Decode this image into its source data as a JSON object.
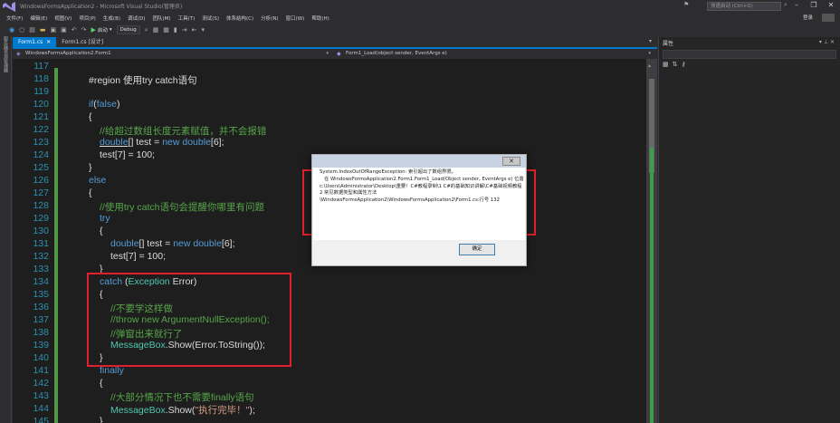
{
  "window": {
    "title": "WindowsFormsApplication2 - Microsoft Visual Studio(管理员)",
    "quick_launch_placeholder": "快速启动 (Ctrl+Q)",
    "minimize": "–",
    "restore": "❐",
    "close": "✕"
  },
  "menu": {
    "items": [
      "文件(F)",
      "编辑(E)",
      "视图(V)",
      "项目(P)",
      "生成(B)",
      "调试(D)",
      "团队(M)",
      "工具(T)",
      "测试(S)",
      "体系结构(C)",
      "分析(N)",
      "窗口(W)",
      "帮助(H)"
    ],
    "signin": "登录"
  },
  "toolbar": {
    "start_label": "启动",
    "config": "Debug"
  },
  "left_strip": {
    "label": "服务器资源管理器"
  },
  "tabs": [
    {
      "label": "Form1.cs",
      "active": true
    },
    {
      "label": "Form1.cs [设计]",
      "active": false
    }
  ],
  "navbar": {
    "class_combo": "WindowsFormsApplication2.Form1",
    "member_combo": "Form1_Load(object sender, EventArgs e)"
  },
  "properties": {
    "title": "属性"
  },
  "editor": {
    "lines": [
      {
        "n": "117",
        "indent": 0,
        "tokens": []
      },
      {
        "n": "118",
        "indent": 1,
        "tokens": [
          {
            "c": "pl",
            "t": "#region 使用try catch语句"
          }
        ]
      },
      {
        "n": "119",
        "indent": 0,
        "tokens": []
      },
      {
        "n": "120",
        "indent": 1,
        "tokens": [
          {
            "c": "kw",
            "t": "if"
          },
          {
            "c": "pl",
            "t": "("
          },
          {
            "c": "kw",
            "t": "false"
          },
          {
            "c": "pl",
            "t": ")"
          }
        ]
      },
      {
        "n": "121",
        "indent": 1,
        "tokens": [
          {
            "c": "pl",
            "t": "{"
          }
        ]
      },
      {
        "n": "122",
        "indent": 2,
        "tokens": [
          {
            "c": "cm",
            "t": "//给超过数组长度元素赋值，并不会报错"
          }
        ]
      },
      {
        "n": "123",
        "indent": 2,
        "tokens": [
          {
            "c": "kw ul",
            "t": "double"
          },
          {
            "c": "pl",
            "t": "[] test = "
          },
          {
            "c": "kw",
            "t": "new"
          },
          {
            "c": "pl",
            "t": " "
          },
          {
            "c": "kw",
            "t": "double"
          },
          {
            "c": "pl",
            "t": "[6];"
          }
        ]
      },
      {
        "n": "124",
        "indent": 2,
        "tokens": [
          {
            "c": "pl",
            "t": "test[7] = 100;"
          }
        ]
      },
      {
        "n": "125",
        "indent": 1,
        "tokens": [
          {
            "c": "pl",
            "t": "}"
          }
        ]
      },
      {
        "n": "126",
        "indent": 1,
        "tokens": [
          {
            "c": "kw",
            "t": "else"
          }
        ]
      },
      {
        "n": "127",
        "indent": 1,
        "tokens": [
          {
            "c": "pl",
            "t": "{"
          }
        ]
      },
      {
        "n": "128",
        "indent": 2,
        "tokens": [
          {
            "c": "cm",
            "t": "//使用try catch语句会提醒你哪里有问题"
          }
        ]
      },
      {
        "n": "129",
        "indent": 2,
        "tokens": [
          {
            "c": "kw",
            "t": "try"
          }
        ]
      },
      {
        "n": "130",
        "indent": 2,
        "tokens": [
          {
            "c": "pl",
            "t": "{"
          }
        ]
      },
      {
        "n": "131",
        "indent": 3,
        "tokens": [
          {
            "c": "kw",
            "t": "double"
          },
          {
            "c": "pl",
            "t": "[] test = "
          },
          {
            "c": "kw",
            "t": "new"
          },
          {
            "c": "pl",
            "t": " "
          },
          {
            "c": "kw",
            "t": "double"
          },
          {
            "c": "pl",
            "t": "[6];"
          }
        ]
      },
      {
        "n": "132",
        "indent": 3,
        "tokens": [
          {
            "c": "pl",
            "t": "test[7] = 100;"
          }
        ]
      },
      {
        "n": "133",
        "indent": 2,
        "tokens": [
          {
            "c": "pl",
            "t": "}"
          }
        ]
      },
      {
        "n": "134",
        "indent": 2,
        "tokens": [
          {
            "c": "kw",
            "t": "catch"
          },
          {
            "c": "pl",
            "t": " ("
          },
          {
            "c": "ty",
            "t": "Exception"
          },
          {
            "c": "pl",
            "t": " Error)"
          }
        ]
      },
      {
        "n": "135",
        "indent": 2,
        "tokens": [
          {
            "c": "pl",
            "t": "{"
          }
        ]
      },
      {
        "n": "136",
        "indent": 3,
        "tokens": [
          {
            "c": "cm",
            "t": "//不要学这样做"
          }
        ]
      },
      {
        "n": "137",
        "indent": 3,
        "tokens": [
          {
            "c": "cm",
            "t": "//throw new ArgumentNullException();"
          }
        ]
      },
      {
        "n": "138",
        "indent": 3,
        "tokens": [
          {
            "c": "cm",
            "t": "//弹窗出来就行了"
          }
        ]
      },
      {
        "n": "139",
        "indent": 3,
        "tokens": [
          {
            "c": "ty",
            "t": "MessageBox"
          },
          {
            "c": "pl",
            "t": ".Show(Error.ToString());"
          }
        ]
      },
      {
        "n": "140",
        "indent": 2,
        "tokens": [
          {
            "c": "pl",
            "t": "}"
          }
        ]
      },
      {
        "n": "141",
        "indent": 2,
        "tokens": [
          {
            "c": "kw",
            "t": "finally"
          }
        ]
      },
      {
        "n": "142",
        "indent": 2,
        "tokens": [
          {
            "c": "pl",
            "t": "{"
          }
        ]
      },
      {
        "n": "143",
        "indent": 3,
        "tokens": [
          {
            "c": "cm",
            "t": "//大部分情况下也不需要finally语句"
          }
        ]
      },
      {
        "n": "144",
        "indent": 3,
        "tokens": [
          {
            "c": "ty",
            "t": "MessageBox"
          },
          {
            "c": "pl",
            "t": ".Show("
          },
          {
            "c": "st",
            "t": "\"执行完毕！\""
          },
          {
            "c": "pl",
            "t": ");"
          }
        ]
      },
      {
        "n": "145",
        "indent": 2,
        "tokens": [
          {
            "c": "pl",
            "t": "}"
          }
        ]
      }
    ]
  },
  "dialog": {
    "message": "System.IndexOutOfRangeException: 索引超出了数组界限。\n   在 WindowsFormsApplication2.Form1.Form1_Load(Object sender, EventArgs e) 位置 c:\\Users\\Administrator\\Desktop\\重要！C#教程录制\\1 C#的基础知识讲解\\C#基础视频教程2 常见数据类型和属性方法\\WindowsFormsApplication2\\WindowsFormsApplication2\\Form1.cs:行号 132",
    "ok_label": "确定",
    "close_label": "✕"
  },
  "colors": {
    "accent": "#007acc",
    "highlight_box": "#e0202e",
    "editor_bg": "#1e1e1e"
  }
}
